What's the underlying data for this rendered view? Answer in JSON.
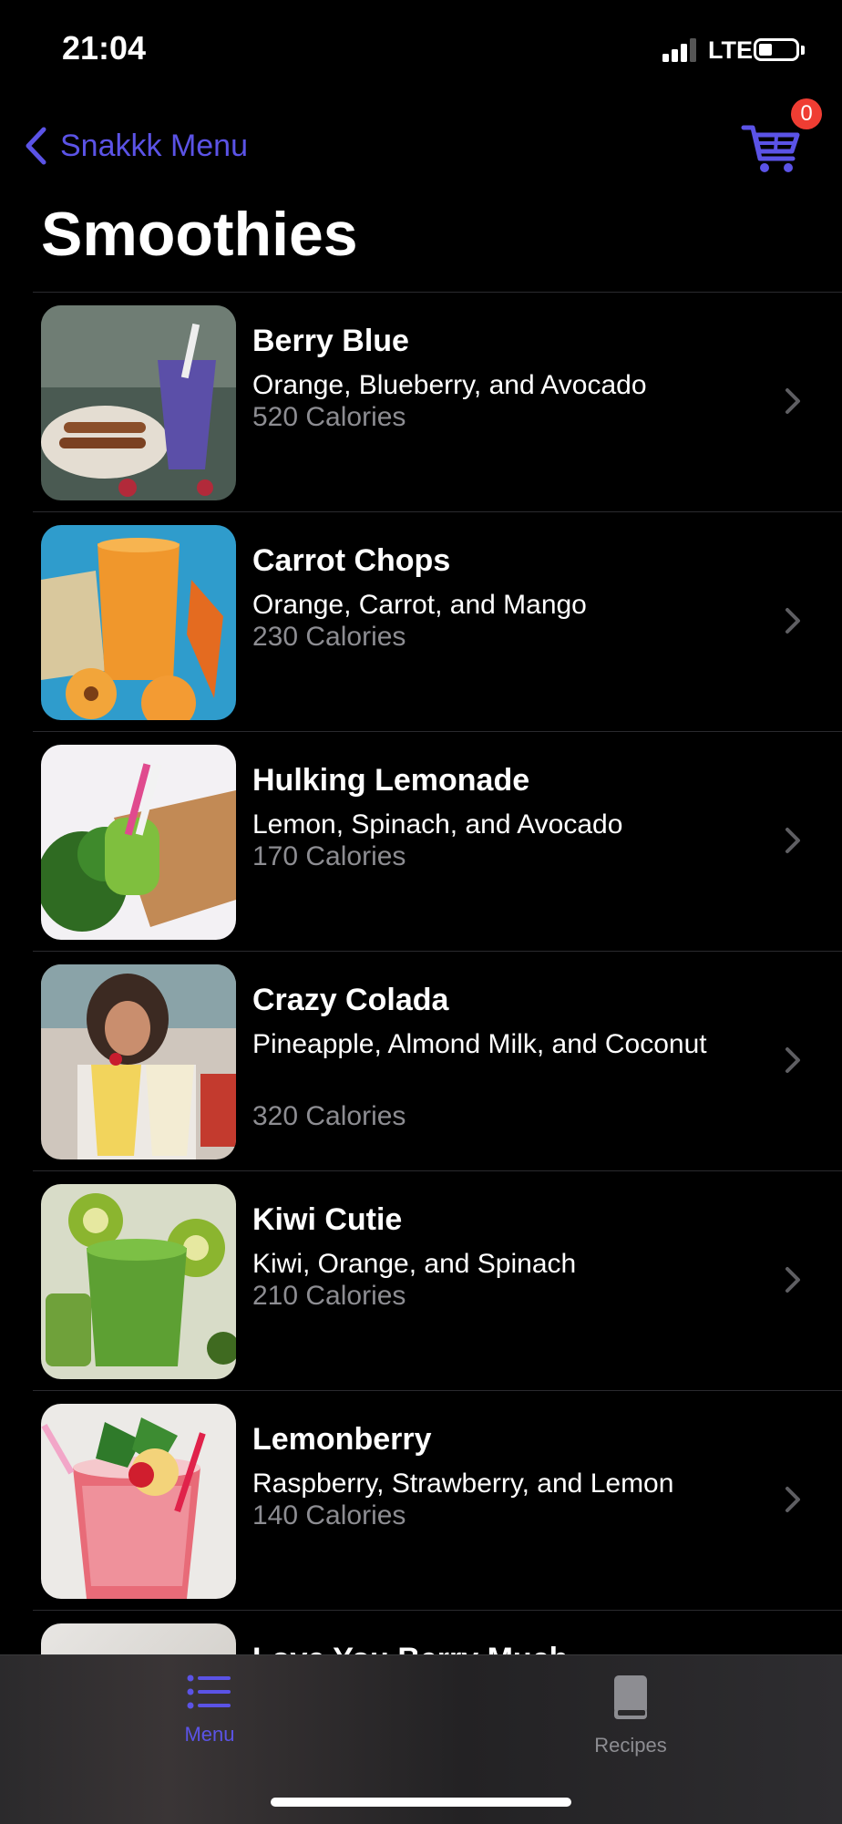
{
  "status": {
    "time": "21:04",
    "network": "LTE"
  },
  "nav": {
    "back_label": "Snakkk Menu",
    "cart_count": "0"
  },
  "title": "Smoothies",
  "items": [
    {
      "name": "Berry Blue",
      "ingredients": "Orange, Blueberry, and Avocado",
      "calories": "520 Calories"
    },
    {
      "name": "Carrot Chops",
      "ingredients": "Orange, Carrot, and Mango",
      "calories": "230 Calories"
    },
    {
      "name": "Hulking Lemonade",
      "ingredients": "Lemon, Spinach, and Avocado",
      "calories": "170 Calories"
    },
    {
      "name": "Crazy Colada",
      "ingredients": "Pineapple, Almond Milk, and Coconut",
      "calories": "320 Calories"
    },
    {
      "name": "Kiwi Cutie",
      "ingredients": "Kiwi, Orange, and Spinach",
      "calories": "210 Calories"
    },
    {
      "name": "Lemonberry",
      "ingredients": "Raspberry, Strawberry, and Lemon",
      "calories": "140 Calories"
    }
  ],
  "partial_item": {
    "name": "Love You Berry Much"
  },
  "tabs": {
    "menu_label": "Menu",
    "recipes_label": "Recipes"
  },
  "colors": {
    "accent": "#5b53e6",
    "badge": "#ef3d33",
    "secondary_text": "#8d8d92"
  }
}
